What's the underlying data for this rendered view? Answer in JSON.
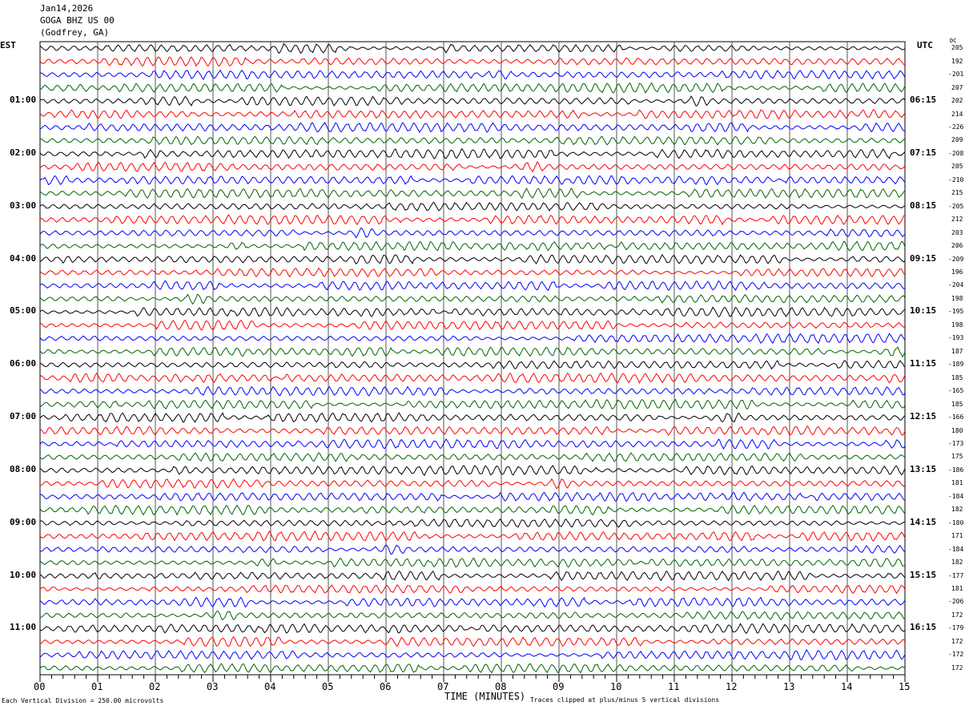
{
  "header": {
    "date": "Jan14,2026",
    "station": "GOGA BHZ US 00",
    "location": "(Godfrey, GA)"
  },
  "left_tz": "EST",
  "right_tz": "UTC",
  "dc_label": "DC",
  "footer": {
    "scale": "Each Vertical Division =  250.00 microvolts",
    "xlabel": "TIME (MINUTES)",
    "clip_note": "Traces clipped at plus/minus 5 vertical divisions"
  },
  "chart_data": {
    "type": "line",
    "xlabel": "TIME (MINUTES)",
    "xlim": [
      0,
      15
    ],
    "x_ticks": [
      "00",
      "01",
      "02",
      "03",
      "04",
      "05",
      "06",
      "07",
      "08",
      "09",
      "10",
      "11",
      "12",
      "13",
      "14",
      "15"
    ],
    "grid": true,
    "trace_colors": [
      "#000000",
      "#ff0000",
      "#0000ff",
      "#006400"
    ],
    "left_hour_labels": [
      "",
      "01:00",
      "02:00",
      "03:00",
      "04:00",
      "05:00",
      "06:00",
      "07:00",
      "08:00",
      "09:00",
      "10:00",
      "11:00"
    ],
    "right_hour_labels": [
      "",
      "06:15",
      "07:15",
      "08:15",
      "09:15",
      "10:15",
      "11:15",
      "12:15",
      "13:15",
      "14:15",
      "15:15",
      "16:15"
    ],
    "dc_offsets": [
      205,
      192,
      -201,
      207,
      202,
      214,
      -226,
      209,
      -208,
      205,
      -210,
      215,
      -205,
      212,
      203,
      206,
      -209,
      196,
      -204,
      198,
      -195,
      198,
      -193,
      187,
      -189,
      185,
      -165,
      185,
      -166,
      180,
      -173,
      175,
      -186,
      181,
      -184,
      182,
      -180,
      171,
      -184,
      182,
      -177,
      181,
      -206,
      172,
      -179,
      172,
      -172,
      172
    ]
  }
}
